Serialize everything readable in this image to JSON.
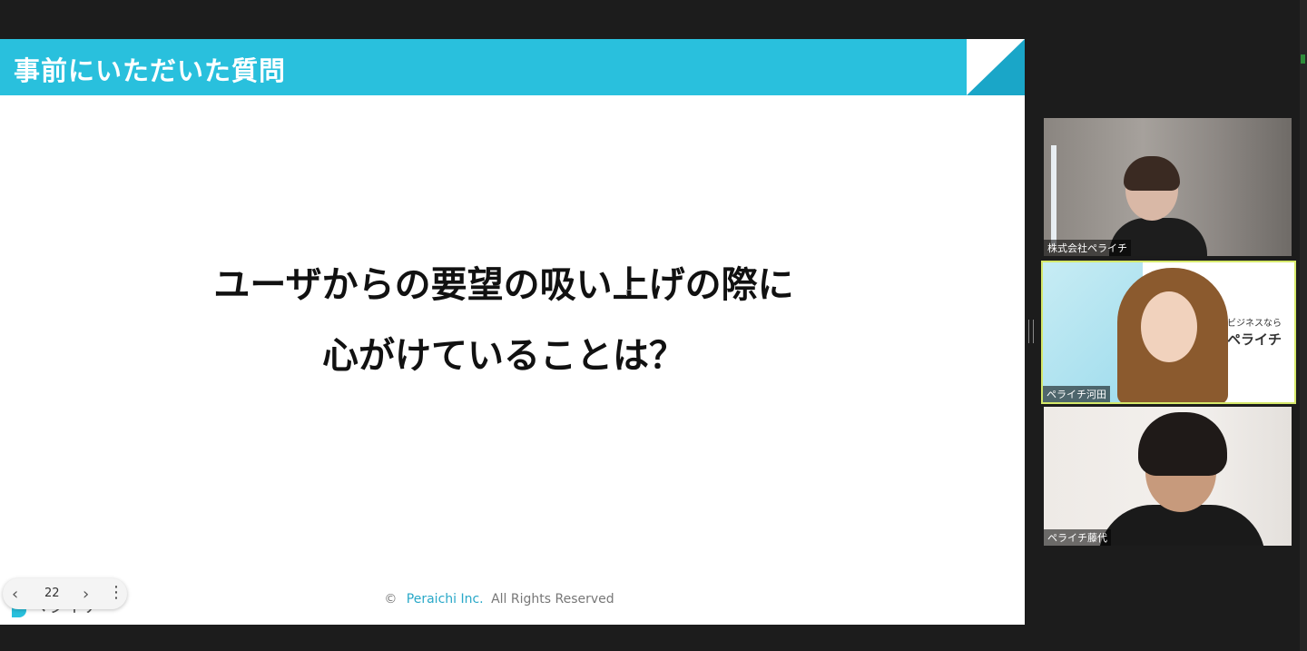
{
  "slide": {
    "title": "事前にいただいた質問",
    "question_line1": "ユーザからの要望の吸い上げの際に",
    "question_line2": "心がけていることは？",
    "footer_copyright": "©",
    "footer_company": "Peraichi Inc.",
    "footer_rights": "All Rights Reserved",
    "logo_text": "ペライチ"
  },
  "slide_nav": {
    "prev_icon": "‹",
    "page_number": "22",
    "next_icon": "›",
    "more_icon": "⋮"
  },
  "participants": [
    {
      "name": "株式会社ペライチ"
    },
    {
      "name": "ペライチ河田",
      "brand_tagline": "ットでビジネスなら",
      "brand_name": "ペライチ"
    },
    {
      "name": "ペライチ藤代"
    }
  ],
  "colors": {
    "header": "#29c0dd",
    "active_speaker_border": "#d5e86a",
    "background": "#1c1c1c"
  }
}
